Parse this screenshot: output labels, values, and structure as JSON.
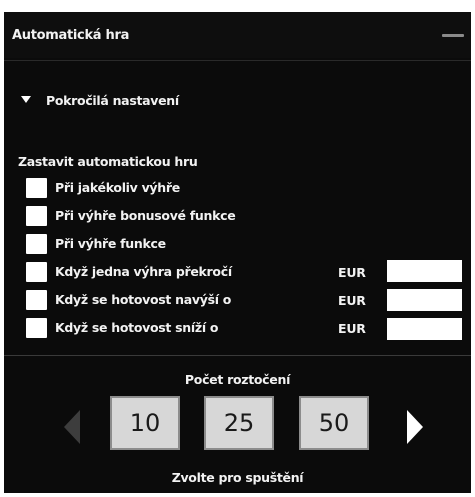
{
  "header": {
    "title": "Automatická hra"
  },
  "advanced": {
    "label": "Pokročilá nastavení"
  },
  "stop_section": {
    "title": "Zastavit automatickou hru",
    "options": [
      {
        "label": "Při jakékoliv výhře"
      },
      {
        "label": "Při výhře bonusové funkce"
      },
      {
        "label": "Při výhře funkce"
      },
      {
        "label": "Když jedna výhra překročí",
        "currency": "EUR"
      },
      {
        "label": "Když se hotovost navýší o",
        "currency": "EUR"
      },
      {
        "label": "Když se hotovost sníží o",
        "currency": "EUR"
      }
    ]
  },
  "spins": {
    "title": "Počet roztočení",
    "values": [
      "10",
      "25",
      "50"
    ],
    "hint": "Zvolte pro spuštění"
  },
  "colors": {
    "panel_bg": "#0b0b0b",
    "text": "#f2f2f2",
    "button_bg": "#d7d7d7",
    "disabled_arrow": "#3d3d3d"
  }
}
